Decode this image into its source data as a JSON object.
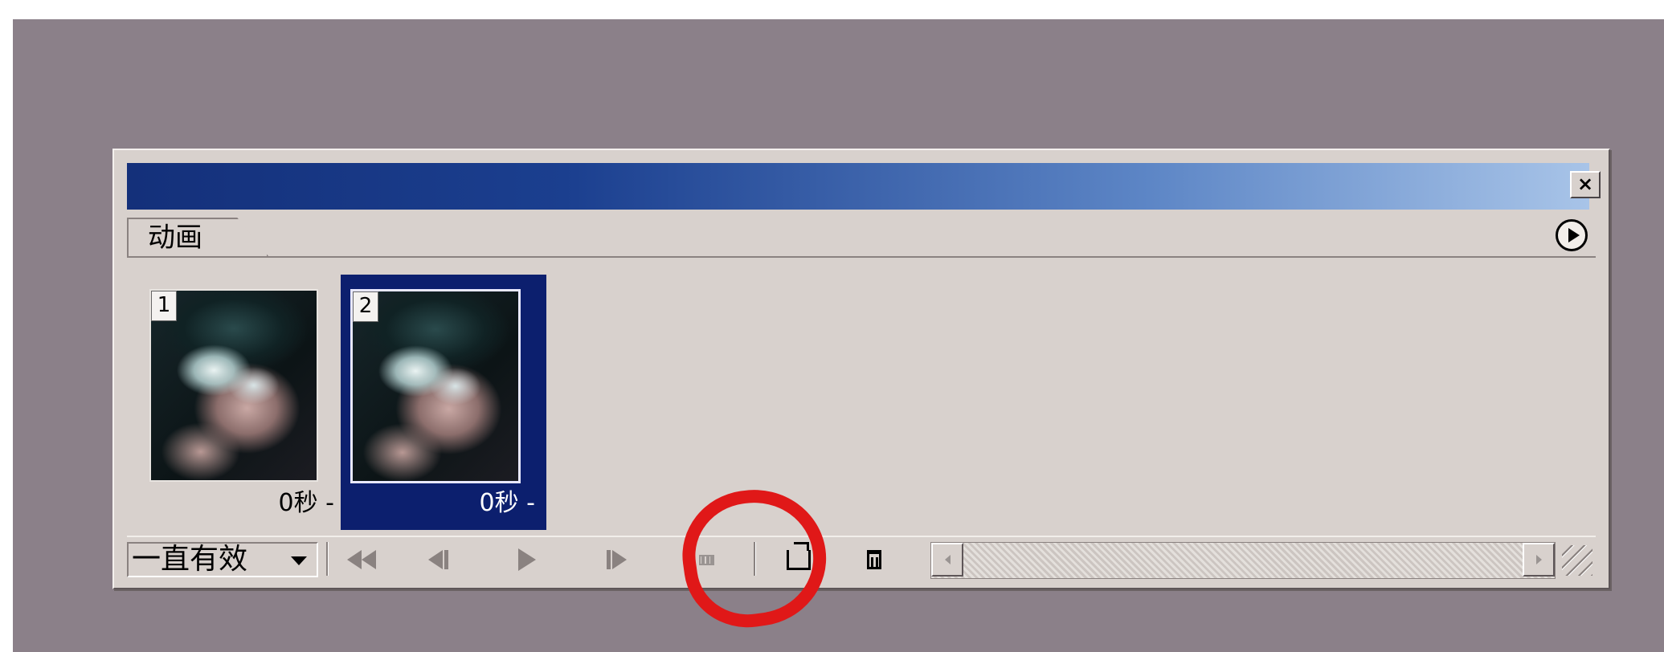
{
  "panel": {
    "tab_label": "动画",
    "frames": [
      {
        "number": "1",
        "delay": "0秒 -",
        "selected": false
      },
      {
        "number": "2",
        "delay": "0秒 -",
        "selected": true
      }
    ],
    "loop_option": "一直有效",
    "toolbar_icons": [
      "first-frame-icon",
      "previous-frame-icon",
      "play-icon",
      "next-frame-icon",
      "tween-icon",
      "new-frame-icon",
      "delete-frame-icon"
    ]
  },
  "colors": {
    "titlebar_start": "#14307a",
    "titlebar_end": "#a8c4e8",
    "selected_frame": "#0c1f6e",
    "annotation": "#e01818"
  }
}
